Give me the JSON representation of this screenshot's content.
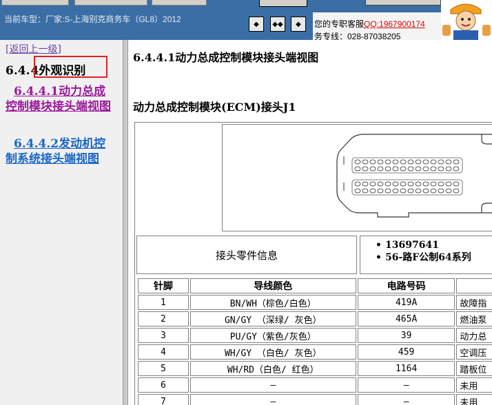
{
  "header": {
    "car_label": "当前车型：厂家:S-上海别克商务车（GL8）2012",
    "nav_buttons": [
      "◆",
      "◆◆",
      "◆"
    ],
    "support_text": "您的专职客服",
    "support_qq": "QQ:1967900174",
    "support_phone": "务专线：028-87038205"
  },
  "left": {
    "back_link": "[返回上一级]",
    "section_number": "6.4.",
    "section_title": "4外观识别",
    "links": [
      {
        "num": "6.4.4.1",
        "text": "动力总成控制模块接头端视图"
      },
      {
        "num": "6.4.4.2",
        "text": "发动机控制系统接头端视图"
      }
    ]
  },
  "main": {
    "title": "6.4.4.1动力总成控制模块接头端视图",
    "subtitle": "动力总成控制模块(ECM)接头J1",
    "info_label": "接头零件信息",
    "info_items": [
      "13697641",
      "56-路F公制64系列"
    ],
    "columns": [
      "针脚",
      "导线颜色",
      "电路号码",
      ""
    ],
    "rows": [
      {
        "pin": "1",
        "color": "BN/WH（棕色/白色）",
        "circuit": "419A",
        "func": "故障指"
      },
      {
        "pin": "2",
        "color": "GN/GY （深绿/ 灰色）",
        "circuit": "465A",
        "func": "燃油泵"
      },
      {
        "pin": "3",
        "color": "PU/GY（紫色/灰色）",
        "circuit": "39",
        "func": "动力总"
      },
      {
        "pin": "4",
        "color": "WH/GY （白色/ 灰色）",
        "circuit": "459",
        "func": "空调压"
      },
      {
        "pin": "5",
        "color": "WH/RD（白色/ 红色）",
        "circuit": "1164",
        "func": "踏板位"
      },
      {
        "pin": "6",
        "color": "–",
        "circuit": "–",
        "func": "未用"
      },
      {
        "pin": "7",
        "color": "–",
        "circuit": "–",
        "func": "未用"
      }
    ]
  },
  "colors": {
    "header_bg": "#3a6ea5",
    "highlight": "#e02020",
    "visited_link": "#9a1a9a",
    "link": "#1a66c8"
  }
}
